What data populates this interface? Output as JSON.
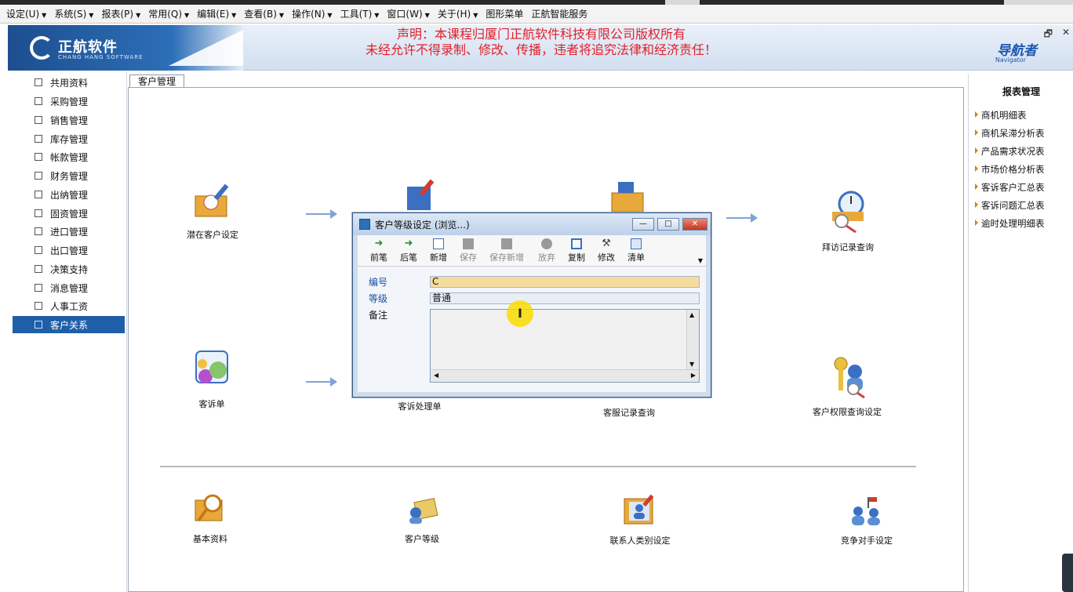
{
  "menubar": {
    "items": [
      {
        "label": "设定(U)"
      },
      {
        "label": "系统(S)"
      },
      {
        "label": "报表(P)"
      },
      {
        "label": "常用(Q)"
      },
      {
        "label": "编辑(E)"
      },
      {
        "label": "查看(B)"
      },
      {
        "label": "操作(N)"
      },
      {
        "label": "工具(T)"
      },
      {
        "label": "窗口(W)"
      },
      {
        "label": "关于(H)"
      },
      {
        "label": "图形菜单"
      },
      {
        "label": "正航智能服务"
      }
    ]
  },
  "header": {
    "logo_text": "正航软件",
    "logo_sub": "CHANG HANG SOFTWARE",
    "notice_line1": "声明：本课程归厦门正航软件科技有限公司版权所有",
    "notice_line2": "未经允许不得录制、修改、传播，违者将追究法律和经济责任！",
    "navigator_title": "导航者",
    "navigator_sub": "Navigator"
  },
  "sidebar": {
    "items": [
      {
        "label": "共用资料",
        "icon": "document-icon"
      },
      {
        "label": "采购管理",
        "icon": "cart-icon"
      },
      {
        "label": "销售管理",
        "icon": "sales-icon"
      },
      {
        "label": "库存管理",
        "icon": "warehouse-icon"
      },
      {
        "label": "帐款管理",
        "icon": "ledger-icon"
      },
      {
        "label": "财务管理",
        "icon": "finance-icon"
      },
      {
        "label": "出纳管理",
        "icon": "cashier-icon"
      },
      {
        "label": "固资管理",
        "icon": "assets-icon"
      },
      {
        "label": "进口管理",
        "icon": "import-icon"
      },
      {
        "label": "出口管理",
        "icon": "export-icon"
      },
      {
        "label": "决策支持",
        "icon": "decision-icon"
      },
      {
        "label": "消息管理",
        "icon": "message-icon"
      },
      {
        "label": "人事工资",
        "icon": "hr-icon"
      },
      {
        "label": "客户关系",
        "icon": "crm-icon",
        "active": true
      }
    ]
  },
  "main": {
    "tab_label": "客户管理",
    "nodes": {
      "potential": "潜在客户设定",
      "complaint": "客诉单",
      "complaint_process": "客诉处理单",
      "service_query": "客服记录查询",
      "visit_query": "拜访记录查询",
      "permission": "客户权限查询设定",
      "basic": "基本资料",
      "level": "客户等级",
      "contact_type": "联系人类别设定",
      "competitor": "竞争对手设定"
    }
  },
  "right_panel": {
    "title": "报表管理",
    "items": [
      "商机明细表",
      "商机呆滞分析表",
      "产品需求状况表",
      "市场价格分析表",
      "客诉客户汇总表",
      "客诉问题汇总表",
      "逾时处理明细表"
    ]
  },
  "dialog": {
    "title": "客户等级设定 (浏览...)",
    "toolbar": [
      {
        "label": "前笔",
        "enabled": true,
        "icon": "arrow-left-icon"
      },
      {
        "label": "后笔",
        "enabled": true,
        "icon": "arrow-right-icon"
      },
      {
        "label": "新增",
        "enabled": true,
        "icon": "new-doc-icon"
      },
      {
        "label": "保存",
        "enabled": false,
        "icon": "save-icon"
      },
      {
        "label": "保存新增",
        "enabled": false,
        "icon": "save-new-icon"
      },
      {
        "label": "放弃",
        "enabled": false,
        "icon": "discard-icon"
      },
      {
        "label": "复制",
        "enabled": true,
        "icon": "copy-icon"
      },
      {
        "label": "修改",
        "enabled": true,
        "icon": "edit-icon"
      },
      {
        "label": "清单",
        "enabled": true,
        "icon": "list-icon"
      }
    ],
    "fields": {
      "code_label": "编号",
      "code_value": "C",
      "grade_label": "等级",
      "grade_value": "普通",
      "remark_label": "备注",
      "remark_value": ""
    }
  }
}
